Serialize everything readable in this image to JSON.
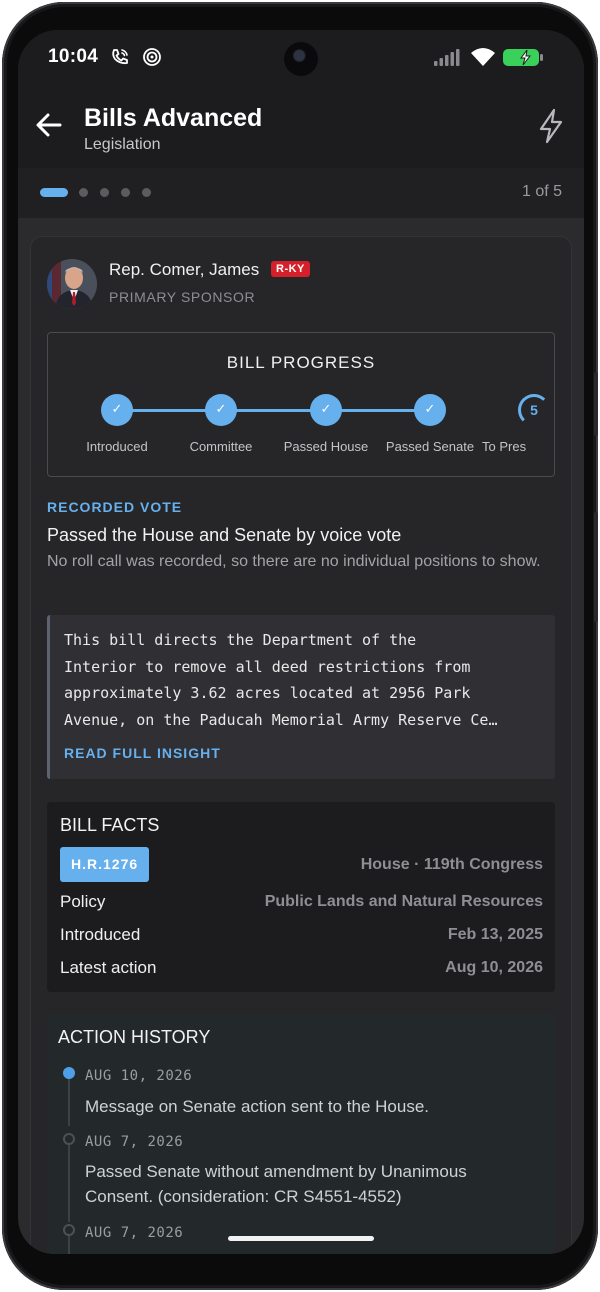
{
  "status_bar": {
    "time": "10:04",
    "icons": [
      "wifi-calling-icon",
      "hotspot-icon",
      "signal-icon",
      "wifi-icon",
      "battery-charging-icon"
    ]
  },
  "app_bar": {
    "title": "Bills Advanced",
    "subtitle": "Legislation",
    "back_icon": "arrow-left-icon",
    "action_icon": "lightning-bolt-icon"
  },
  "pager": {
    "page_count": "1 of 5",
    "total_pages": 5,
    "active_index": 0
  },
  "sponsor": {
    "name": "Rep. Comer, James",
    "party": "R-KY",
    "role": "PRIMARY SPONSOR"
  },
  "progress": {
    "title": "BILL PROGRESS",
    "steps": [
      {
        "label": "Introduced",
        "done": true
      },
      {
        "label": "Committee",
        "done": true
      },
      {
        "label": "Passed House",
        "done": true
      },
      {
        "label": "Passed Senate",
        "done": true
      },
      {
        "label": "To Pres",
        "done": false,
        "number": "5"
      }
    ]
  },
  "vote": {
    "kicker": "RECORDED VOTE",
    "headline": "Passed the House and Senate by voice vote",
    "note": "No roll call was recorded, so there are no individual positions to show."
  },
  "insight": {
    "lines": [
      "This bill directs the Department of the",
      "Interior to remove all deed restrictions from",
      "approximately 3.62 acres located at 2956 Park",
      "Avenue, on the Paducah Memorial Army Reserve Ce…"
    ],
    "read_more": "READ FULL INSIGHT"
  },
  "facts": {
    "title": "BILL FACTS",
    "bill_number": "H.R.1276",
    "chamber_congress": "House · 119th Congress",
    "rows": [
      {
        "label": "Policy",
        "value": "Public Lands and Natural Resources"
      },
      {
        "label": "Introduced",
        "value": "Feb 13, 2025"
      },
      {
        "label": "Latest action",
        "value": "Aug 10, 2026"
      }
    ]
  },
  "history": {
    "title": "ACTION HISTORY",
    "items": [
      {
        "date": "AUG 10, 2026",
        "text": "Message on Senate action sent to the House.",
        "latest": true
      },
      {
        "date": "AUG 7, 2026",
        "text": "Passed Senate without amendment by Unanimous Consent. (consideration: CR S4551-4552)",
        "latest": false
      },
      {
        "date": "AUG 7, 2026",
        "text": "",
        "latest": false
      }
    ]
  },
  "colors": {
    "accent": "#66b0ee",
    "party_badge": "#d4202a",
    "background": "#2b2b2e"
  }
}
